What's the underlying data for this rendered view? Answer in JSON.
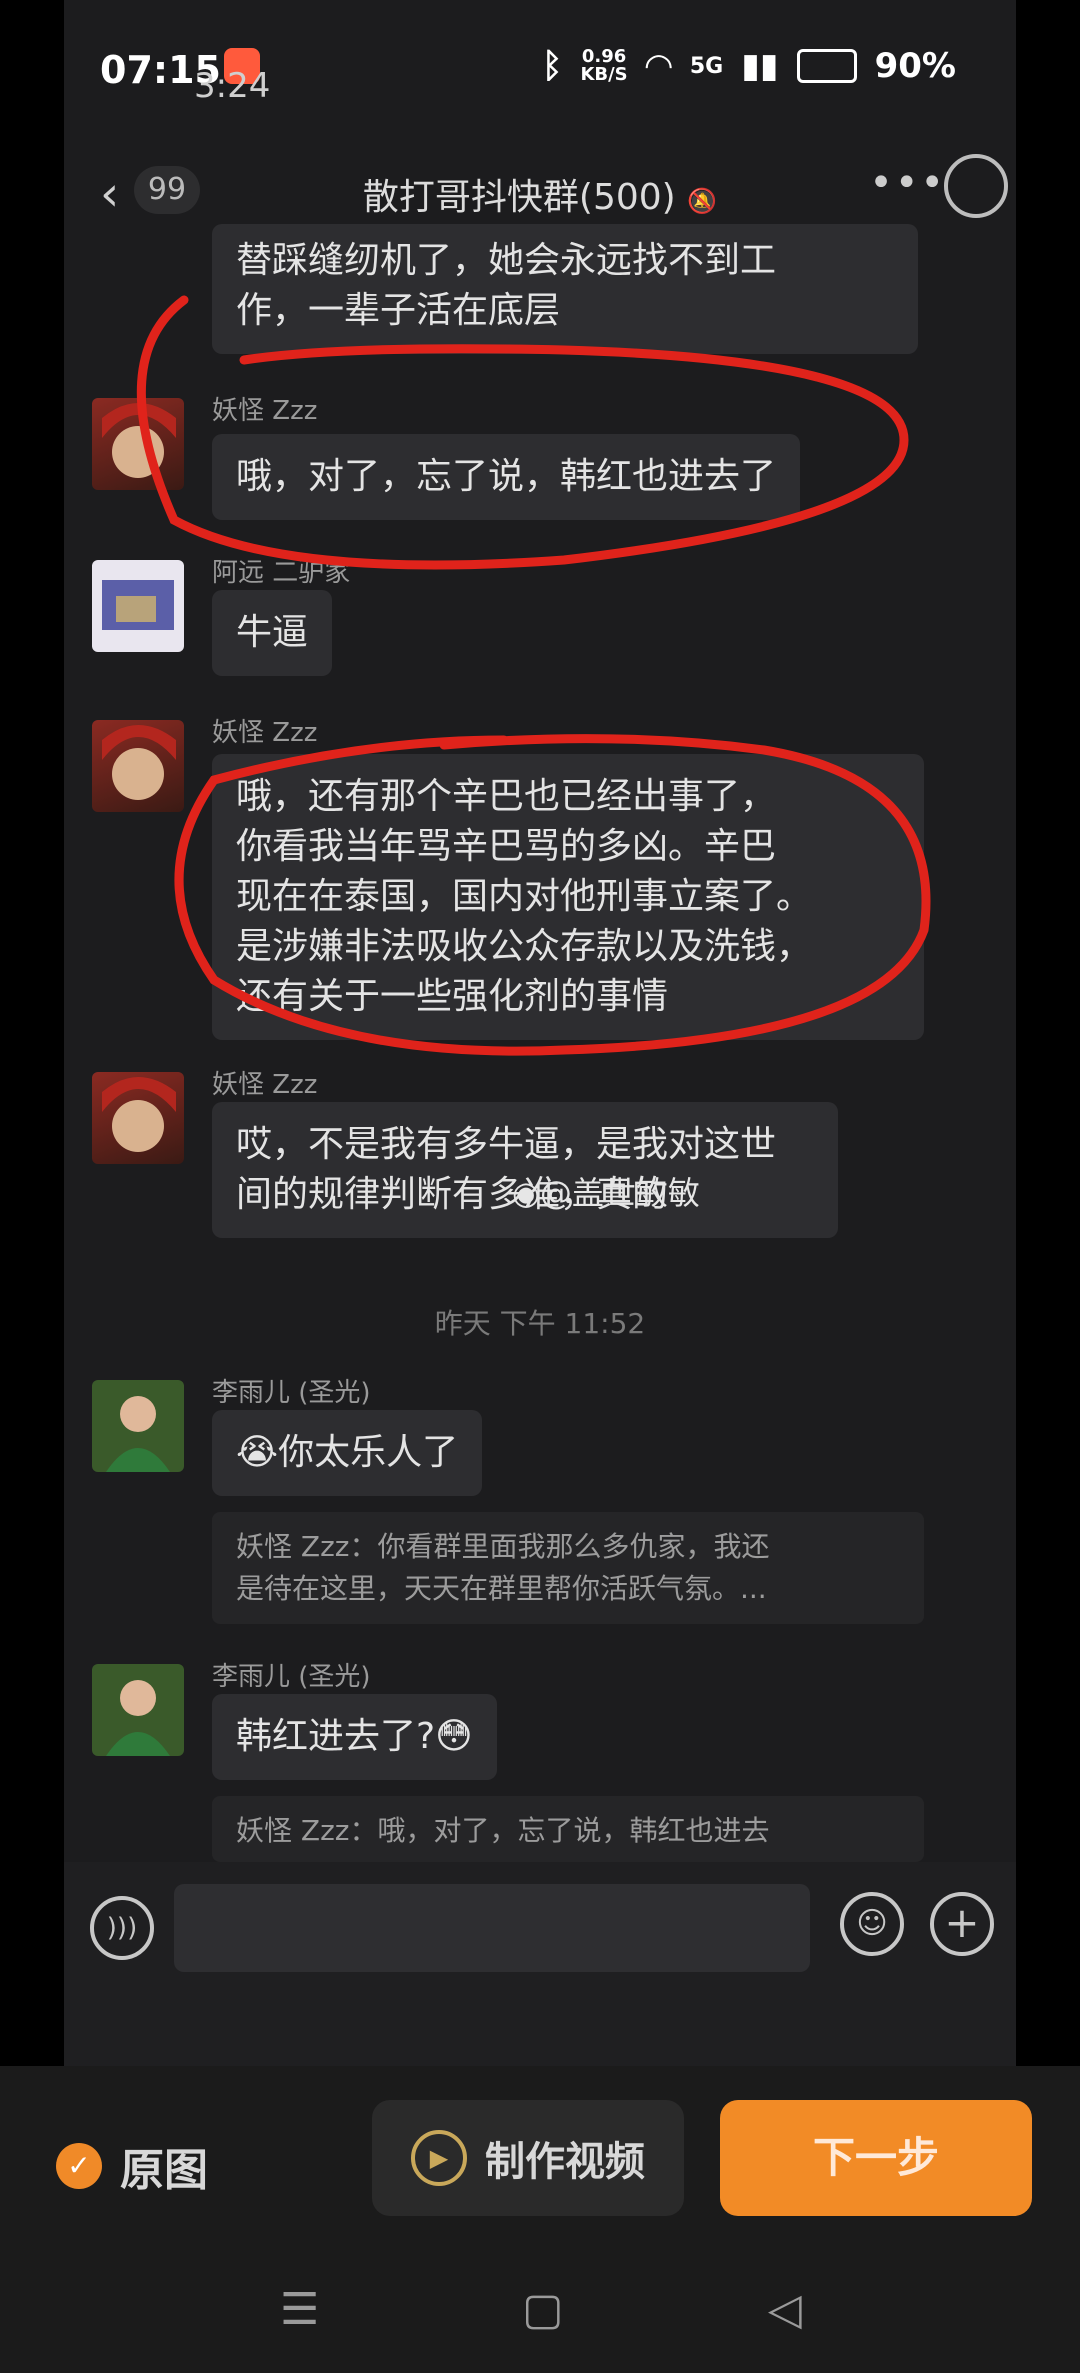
{
  "status": {
    "time": "07:15",
    "time_overlay": "3:24",
    "speed": "0.96",
    "speed_unit": "KB/S",
    "network": "5G",
    "battery": "90%"
  },
  "header": {
    "back_count": "99",
    "title": "散打哥抖快群(500)"
  },
  "messages": [
    {
      "type": "text",
      "lines": [
        "替踩缝纫机了，她会永远找不到工",
        "作，一辈子活在底层"
      ]
    },
    {
      "type": "text",
      "sender": "妖怪 Zzz",
      "text": "哦，对了，忘了说，韩红也进去了"
    },
    {
      "type": "text",
      "sender": "阿远 二驴家",
      "text": "牛逼"
    },
    {
      "type": "text",
      "sender": "妖怪 Zzz",
      "lines": [
        "哦，还有那个辛巴也已经出事了，",
        "你看我当年骂辛巴骂的多凶。辛巴",
        "现在在泰国，国内对他刑事立案了。",
        "是涉嫌非法吸收公众存款以及洗钱，",
        "还有关于一些强化剂的事情"
      ]
    },
    {
      "type": "text",
      "sender": "妖怪 Zzz",
      "lines": [
        "哎，不是我有多牛逼，是我对这世",
        "间的规律判断有多准，真的"
      ]
    },
    {
      "type": "timestamp",
      "text": "昨天 下午 11:52"
    },
    {
      "type": "text",
      "sender": "李雨儿 (圣光)",
      "text": "😭你太乐人了",
      "quote_lines": [
        "妖怪 Zzz：你看群里面我那么多仇家，我还",
        "是待在这里，天天在群里帮你活跃气氛。..."
      ]
    },
    {
      "type": "text",
      "sender": "李雨儿 (圣光)",
      "text": "韩红进去了?😳",
      "quote": "妖怪 Zzz：哦，对了，忘了说，韩红也进去"
    }
  ],
  "watermark": "@盖世敏敏",
  "bottom": {
    "original": "原图",
    "make_video": "制作视频",
    "next": "下一步"
  },
  "colors": {
    "accent": "#f28b26",
    "annotation": "#e0231b",
    "background": "#1c1c1e",
    "bubble": "#2d2d30"
  }
}
